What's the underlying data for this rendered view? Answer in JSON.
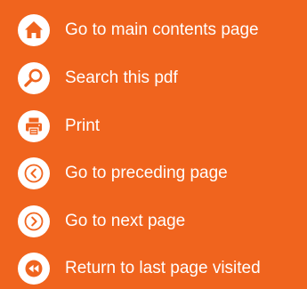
{
  "colors": {
    "background": "#f0641e",
    "circle": "#ffffff",
    "icon": "#f0641e",
    "text": "#ffffff"
  },
  "nav": {
    "items": [
      {
        "label": "Go to main contents page",
        "icon": "home-icon"
      },
      {
        "label": "Search this pdf",
        "icon": "search-icon"
      },
      {
        "label": "Print",
        "icon": "printer-icon"
      },
      {
        "label": "Go to preceding page",
        "icon": "chevron-left-icon"
      },
      {
        "label": "Go to next page",
        "icon": "chevron-right-icon"
      },
      {
        "label": "Return to last page visited",
        "icon": "rewind-icon"
      }
    ]
  }
}
